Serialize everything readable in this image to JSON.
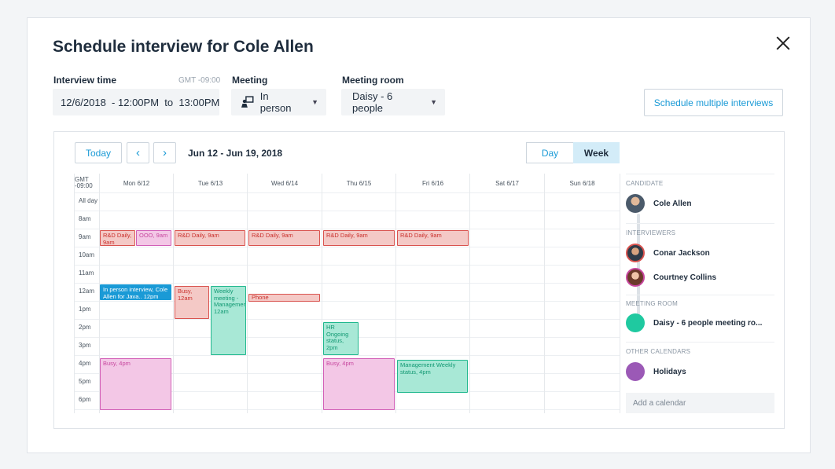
{
  "dialog": {
    "title": "Schedule interview for Cole Allen",
    "interview_time_label": "Interview time",
    "timezone": "GMT -09:00",
    "interview_time_value": "12/6/2018  - 12:00PM  to  13:00PM",
    "meeting_label": "Meeting",
    "meeting_value": "In person",
    "meeting_room_label": "Meeting room",
    "meeting_room_value": "Daisy - 6 people",
    "multi_button": "Schedule multiple interviews"
  },
  "calendar": {
    "today": "Today",
    "range": "Jun 12 - Jun 19, 2018",
    "view_day": "Day",
    "view_week": "Week",
    "gmt_label": "GMT -09:00",
    "days": [
      "Mon 6/12",
      "Tue 6/13",
      "Wed 6/14",
      "Thu 6/15",
      "Fri 6/16",
      "Sat 6/17",
      "Sun 6/18"
    ],
    "allday": "All day",
    "hours": [
      "8am",
      "9am",
      "10am",
      "11am",
      "12am",
      "1pm",
      "2pm",
      "3pm",
      "4pm",
      "5pm",
      "6pm"
    ],
    "events": [
      {
        "text": "R&D Daily, 9am"
      },
      {
        "text": "OOO, 9am"
      },
      {
        "text": "R&D Daily, 9am"
      },
      {
        "text": "R&D Daily, 9am"
      },
      {
        "text": "R&D Daily, 9am"
      },
      {
        "text": "R&D Daily, 9am"
      },
      {
        "text": "In person interview, Cole Allen for Java.. 12pm"
      },
      {
        "text": "Busy, 12am"
      },
      {
        "text": "Weekly meeting - Management, 12am"
      },
      {
        "text": "Phone intervie...12:30am"
      },
      {
        "text": "HR Ongoing status, 2pm"
      },
      {
        "text": "Busy, 4pm"
      },
      {
        "text": "Busy, 4pm"
      },
      {
        "text": "Management Weekly status, 4pm"
      }
    ]
  },
  "side": {
    "candidate_label": "CANDIDATE",
    "candidate": "Cole Allen",
    "interviewers_label": "INTERVIEWERS",
    "interviewers": [
      "Conar Jackson",
      "Courtney Collins"
    ],
    "room_label": "MEETING ROOM",
    "room": "Daisy - 6 people meeting ro...",
    "room_color": "#1fc9a0",
    "other_label": "OTHER CALENDARS",
    "other": "Holidays",
    "other_color": "#9b59b6",
    "add_calendar": "Add a calendar"
  }
}
